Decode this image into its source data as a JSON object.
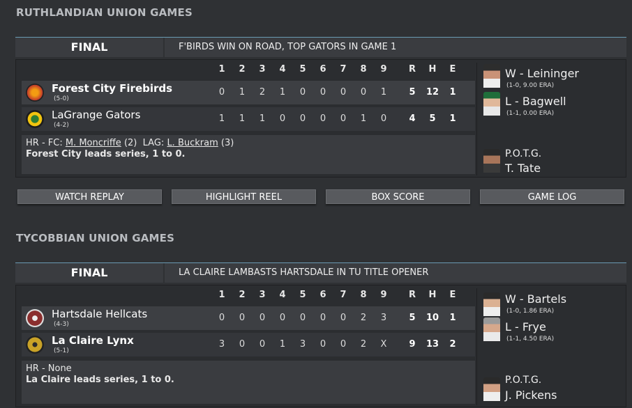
{
  "sections": [
    {
      "title": "RUTHLANDIAN UNION GAMES",
      "status": "FINAL",
      "headline": "F'BIRDS WIN ON ROAD, TOP GATORS IN GAME 1",
      "innings_header": [
        "1",
        "2",
        "3",
        "4",
        "5",
        "6",
        "7",
        "8",
        "9"
      ],
      "totals_header": [
        "R",
        "H",
        "E"
      ],
      "teams": [
        {
          "name": "Forest City Firebirds",
          "record": "(5-0)",
          "innings": [
            "0",
            "1",
            "2",
            "1",
            "0",
            "0",
            "0",
            "0",
            "1"
          ],
          "totals": [
            "5",
            "12",
            "1"
          ],
          "winner": true,
          "logo_color": "#c0392b"
        },
        {
          "name": "LaGrange Gators",
          "record": "(4-2)",
          "innings": [
            "1",
            "1",
            "1",
            "0",
            "0",
            "0",
            "0",
            "1",
            "0"
          ],
          "totals": [
            "4",
            "5",
            "1"
          ],
          "winner": false,
          "logo_color": "#6fae3c"
        }
      ],
      "hr_prefix": "HR - FC:",
      "hr_player_1": "M. Moncriffe",
      "hr_count_1": "(2)",
      "hr_mid": "LAG:",
      "hr_player_2": "L. Buckram",
      "hr_count_2": "(3)",
      "series_note": "Forest City leads series, 1 to 0.",
      "win_pitcher": "W - Leininger",
      "win_stat": "(1-0, 9.00 ERA)",
      "loss_pitcher": "L - Bagwell",
      "loss_stat": "(1-1, 0.00 ERA)",
      "potg_label": "P.O.T.G.",
      "potg_name": "T. Tate",
      "buttons": [
        "WATCH REPLAY",
        "HIGHLIGHT REEL",
        "BOX SCORE",
        "GAME LOG"
      ]
    },
    {
      "title": "TYCOBBIAN UNION GAMES",
      "status": "FINAL",
      "headline": "LA CLAIRE LAMBASTS HARTSDALE IN TU TITLE OPENER",
      "innings_header": [
        "1",
        "2",
        "3",
        "4",
        "5",
        "6",
        "7",
        "8",
        "9"
      ],
      "totals_header": [
        "R",
        "H",
        "E"
      ],
      "teams": [
        {
          "name": "Hartsdale Hellcats",
          "record": "(4-3)",
          "innings": [
            "0",
            "0",
            "0",
            "0",
            "0",
            "0",
            "0",
            "2",
            "3"
          ],
          "totals": [
            "5",
            "10",
            "1"
          ],
          "winner": false,
          "logo_color": "#8b2e2e"
        },
        {
          "name": "La Claire Lynx",
          "record": "(5-1)",
          "innings": [
            "3",
            "0",
            "0",
            "1",
            "3",
            "0",
            "0",
            "2",
            "X"
          ],
          "totals": [
            "9",
            "13",
            "2"
          ],
          "winner": true,
          "logo_color": "#c9a227"
        }
      ],
      "hr_text": "HR - None",
      "series_note": "La Claire leads series, 1 to 0.",
      "win_pitcher": "W - Bartels",
      "win_stat": "(1-0, 1.86 ERA)",
      "loss_pitcher": "L - Frye",
      "loss_stat": "(1-1, 4.50 ERA)",
      "potg_label": "P.O.T.G.",
      "potg_name": "J. Pickens"
    }
  ]
}
